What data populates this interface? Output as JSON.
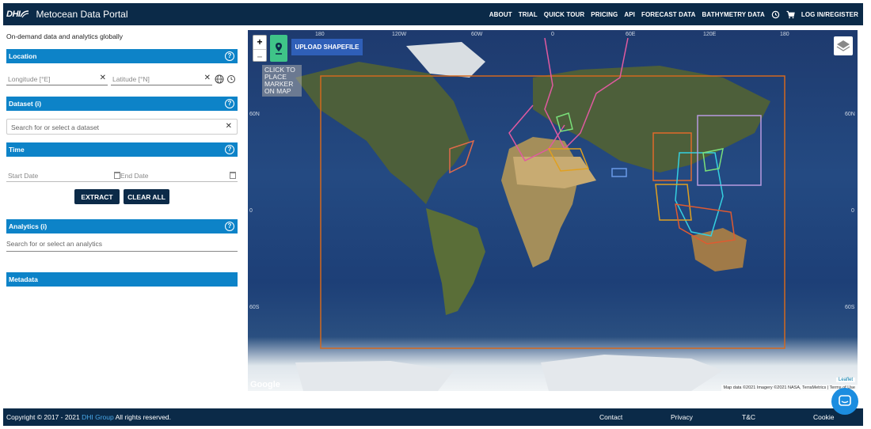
{
  "header": {
    "logo_text": "DHI",
    "title": "Metocean Data Portal",
    "nav": [
      "ABOUT",
      "TRIAL",
      "QUICK TOUR",
      "PRICING",
      "API",
      "FORECAST DATA",
      "BATHYMETRY DATA"
    ],
    "login": "LOG IN/REGISTER",
    "icons": [
      "history-icon",
      "cart-icon"
    ]
  },
  "sidebar": {
    "tagline": "On-demand data and analytics globally",
    "location": {
      "title": "Location",
      "longitude_placeholder": "Longitude [°E]",
      "latitude_placeholder": "Latitude [°N]"
    },
    "dataset": {
      "title": "Dataset (i)",
      "placeholder": "Search for or select a dataset"
    },
    "time": {
      "title": "Time",
      "start_placeholder": "Start Date",
      "end_placeholder": "End Date"
    },
    "buttons": {
      "extract": "EXTRACT",
      "clear": "CLEAR ALL"
    },
    "analytics": {
      "title": "Analytics (i)",
      "placeholder": "Search for or select an analytics"
    },
    "metadata": {
      "title": "Metadata"
    }
  },
  "map": {
    "zoom_in": "+",
    "zoom_out": "–",
    "upload_label": "UPLOAD SHAPEFILE",
    "marker_hint": "CLICK TO PLACE MARKER ON MAP",
    "google": "Google",
    "attribution": "Map data ©2021 Imagery ©2021 NASA, TerraMetrics  |  Terms of Use",
    "leaflet": "Leaflet",
    "lon_labels": [
      "180",
      "120W",
      "60W",
      "0",
      "60E",
      "120E",
      "180"
    ],
    "lat_labels": [
      "60N",
      "0",
      "60S"
    ],
    "colors": {
      "orange": "#d2691e",
      "pink": "#e05aa0",
      "cyan": "#35d0e0",
      "lavender": "#b89ae0",
      "green": "#7ae07a"
    }
  },
  "footer": {
    "copyright_prefix": "Copyright © 2017 - 2021 ",
    "copyright_link": "DHI Group",
    "copyright_suffix": " All rights reserved.",
    "links": [
      "Contact",
      "Privacy",
      "T&C",
      "Cookie"
    ]
  },
  "colors": {
    "navy": "#0b2a48",
    "section_blue": "#0d83c8",
    "upload_blue": "#2f5fb8",
    "marker_green": "#3fc488"
  }
}
